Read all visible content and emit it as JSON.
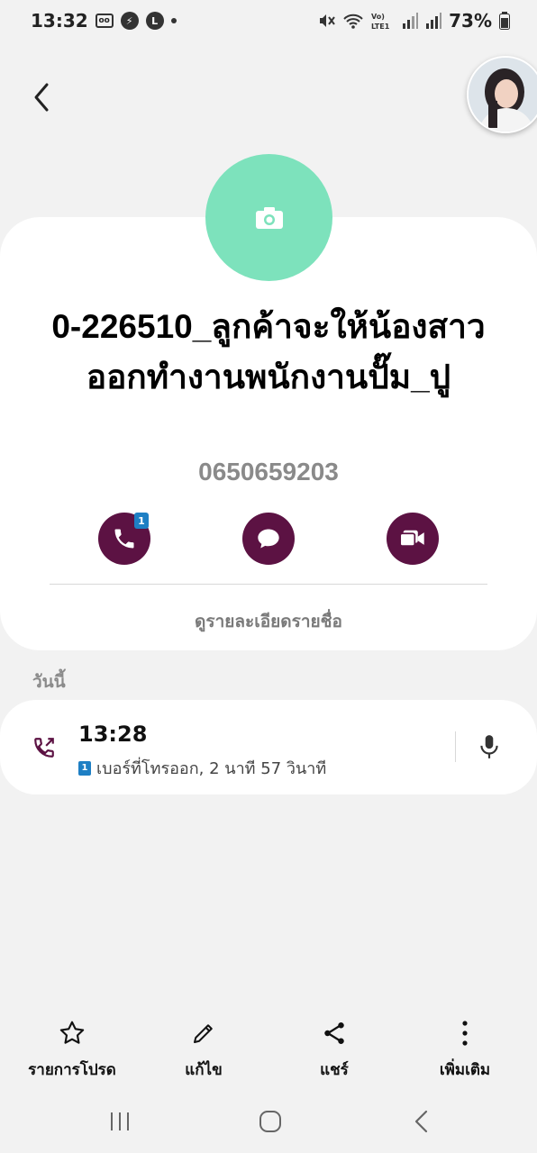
{
  "status_bar": {
    "time": "13:32",
    "battery": "73%",
    "left_icons": [
      "voicemail-icon",
      "messenger-icon",
      "line-icon",
      "dot-icon"
    ],
    "right_icons": [
      "mute-icon",
      "wifi-icon",
      "volte-icon",
      "signal-icon",
      "signal-icon",
      "battery-icon"
    ]
  },
  "contact": {
    "name": "0-226510_ลูกค้าจะให้น้องสาวออกทำงานพนักงานปั๊ม_ปู",
    "phone": "0650659203",
    "details_link": "ดูรายละเอียดรายชื่อ",
    "call_sim_badge": "1"
  },
  "actions": [
    {
      "name": "call",
      "icon": "phone-icon"
    },
    {
      "name": "message",
      "icon": "chat-icon"
    },
    {
      "name": "video-call",
      "icon": "video-icon"
    }
  ],
  "history": {
    "section_label": "วันนี้",
    "entries": [
      {
        "time": "13:28",
        "sim": "1",
        "detail": "เบอร์ที่โทรออก, 2 นาที 57 วินาที",
        "icon": "outgoing-call-icon"
      }
    ]
  },
  "bottom_actions": [
    {
      "label": "รายการโปรด",
      "icon": "star-icon"
    },
    {
      "label": "แก้ไข",
      "icon": "pencil-icon"
    },
    {
      "label": "แชร์",
      "icon": "share-icon"
    },
    {
      "label": "เพิ่มเติม",
      "icon": "more-icon"
    }
  ],
  "colors": {
    "accent": "#5c1243",
    "avatar_bg": "#7de2bc",
    "sim_badge": "#1e7fc4",
    "background": "#f2f2f2"
  }
}
